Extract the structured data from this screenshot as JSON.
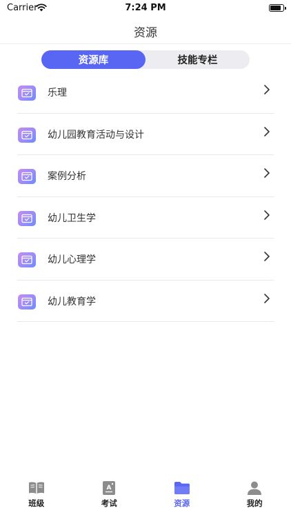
{
  "status_bar": {
    "carrier": "Carrier",
    "time": "7:24 PM"
  },
  "nav": {
    "title": "资源"
  },
  "segment": {
    "tabs": [
      "资源库",
      "技能专栏"
    ],
    "active_index": 0
  },
  "list": {
    "items": [
      {
        "label": "乐理"
      },
      {
        "label": "幼儿园教育活动与设计"
      },
      {
        "label": "案例分析"
      },
      {
        "label": "幼儿卫生学"
      },
      {
        "label": "幼儿心理学"
      },
      {
        "label": "幼儿教育学"
      }
    ]
  },
  "tab_bar": {
    "tabs": [
      {
        "label": "班级",
        "icon": "book-icon"
      },
      {
        "label": "考试",
        "icon": "exam-icon"
      },
      {
        "label": "资源",
        "icon": "folder-icon"
      },
      {
        "label": "我的",
        "icon": "user-icon"
      }
    ],
    "active_index": 2
  },
  "colors": {
    "accent": "#5966f3",
    "icon_gradient_start": "#c48cf0",
    "icon_gradient_end": "#6a8cff",
    "tab_inactive_icon": "#8c8c8c"
  }
}
